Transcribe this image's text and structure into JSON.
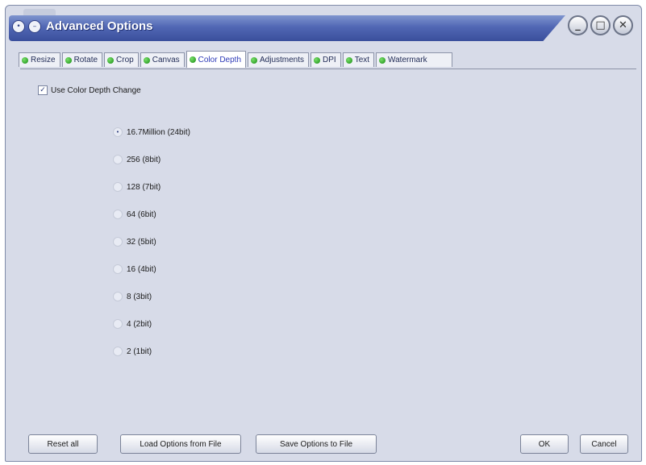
{
  "window": {
    "title": "Advanced Options",
    "title_icons": [
      "close-icon",
      "minimize-icon"
    ],
    "controls": [
      "minimize-icon",
      "maximize-icon",
      "close-icon"
    ]
  },
  "tabs": [
    {
      "label": "Resize",
      "active": false
    },
    {
      "label": "Rotate",
      "active": false
    },
    {
      "label": "Crop",
      "active": false
    },
    {
      "label": "Canvas",
      "active": false
    },
    {
      "label": "Color Depth",
      "active": true
    },
    {
      "label": "Adjustments",
      "active": false
    },
    {
      "label": "DPI",
      "active": false
    },
    {
      "label": "Text",
      "active": false
    },
    {
      "label": "Watermark",
      "active": false
    }
  ],
  "color_depth": {
    "use_change_label": "Use Color Depth Change",
    "use_change_checked": true,
    "options": [
      {
        "label": "16.7Million (24bit)",
        "selected": true
      },
      {
        "label": "256 (8bit)",
        "selected": false
      },
      {
        "label": "128 (7bit)",
        "selected": false
      },
      {
        "label": "64 (6bit)",
        "selected": false
      },
      {
        "label": "32 (5bit)",
        "selected": false
      },
      {
        "label": "16 (4bit)",
        "selected": false
      },
      {
        "label": "8 (3bit)",
        "selected": false
      },
      {
        "label": "4 (2bit)",
        "selected": false
      },
      {
        "label": "2 (1bit)",
        "selected": false
      }
    ]
  },
  "buttons": {
    "reset_all": "Reset all",
    "load_options": "Load Options from File",
    "save_options": "Save Options to File",
    "ok": "OK",
    "cancel": "Cancel"
  },
  "colors": {
    "titlebar": "#4a60ad",
    "tab_indicator": "#2fae24",
    "panel_bg": "#d7dbe8"
  }
}
